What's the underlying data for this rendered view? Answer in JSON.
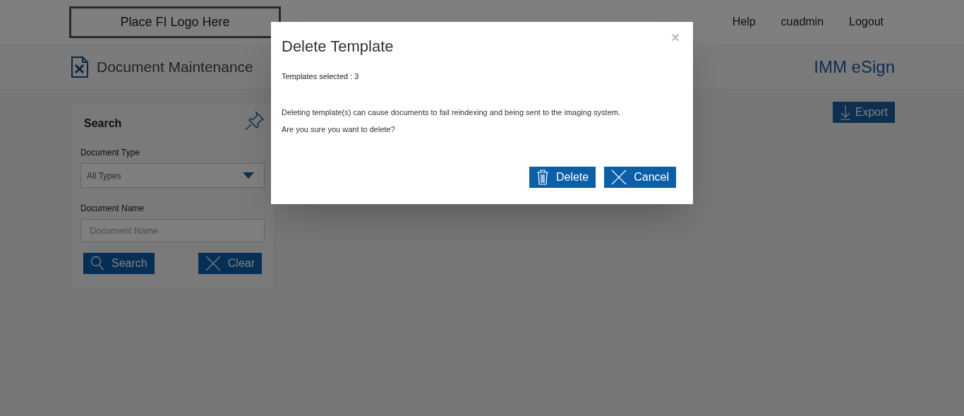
{
  "logo": "Place FI Logo Here",
  "nav": [
    "Help",
    "cuadmin",
    "Logout"
  ],
  "page_title": "Document Maintenance",
  "brand": "IMM eSign",
  "search_panel": {
    "title": "Search",
    "fields": [
      {
        "kind": "select",
        "label": "Document Type",
        "value": "All Types"
      },
      {
        "kind": "text",
        "label": "Document Name",
        "placeholder": "Document Name"
      }
    ],
    "buttons": [
      {
        "kind": "search",
        "label": "Search"
      },
      {
        "kind": "clear",
        "label": "Clear"
      }
    ]
  },
  "export_button": "Export",
  "dialog": {
    "title": "Delete Template",
    "close": "×",
    "selected_count": "Templates selected : 3",
    "message": [
      "Deleting template(s) can cause documents to fail reindexing and being sent to the imaging system.",
      "Are you sure you want to delete?"
    ],
    "buttons": [
      {
        "kind": "delete",
        "label": "Delete"
      },
      {
        "kind": "cancel",
        "label": "Cancel"
      }
    ]
  }
}
